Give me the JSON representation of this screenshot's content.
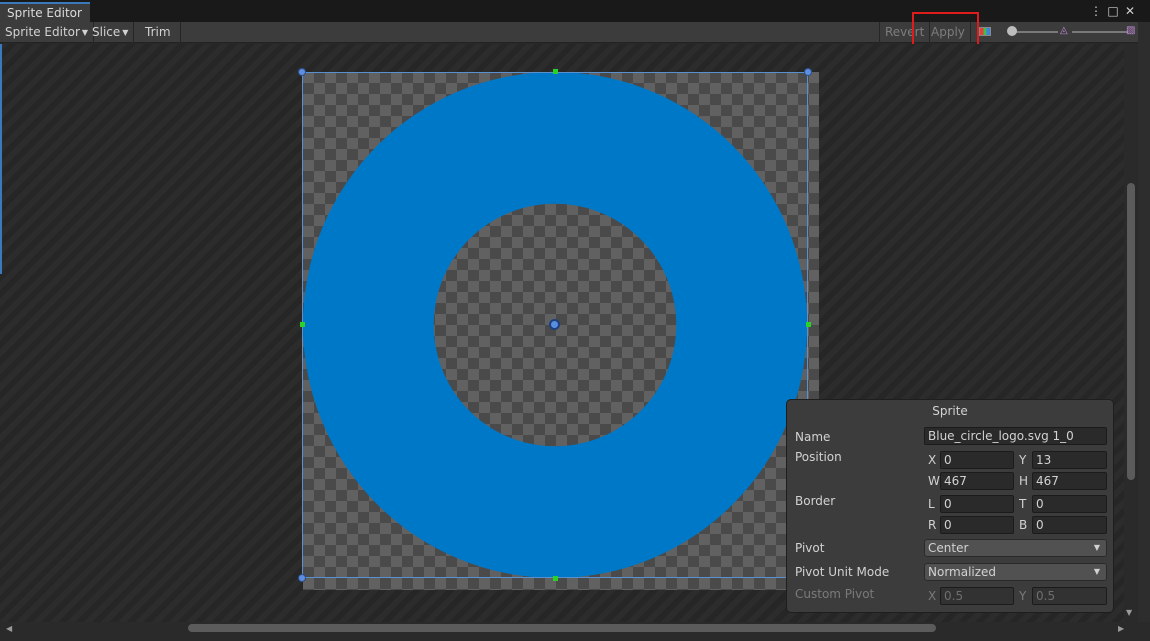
{
  "window": {
    "tab_title": "Sprite Editor",
    "menu_icon": "⋮",
    "maximize_icon": "□",
    "close_icon": "✕"
  },
  "toolbar": {
    "sprite_editor_label": "Sprite Editor",
    "slice_label": "Slice",
    "trim_label": "Trim",
    "revert_label": "Revert",
    "apply_label": "Apply",
    "dropdown_caret": "▼"
  },
  "sprite_panel": {
    "title": "Sprite",
    "name_label": "Name",
    "name_value": "Blue_circle_logo.svg 1_0",
    "position_label": "Position",
    "x_label": "X",
    "x_value": "0",
    "y_label": "Y",
    "y_value": "13",
    "w_label": "W",
    "w_value": "467",
    "h_label": "H",
    "h_value": "467",
    "border_label": "Border",
    "l_label": "L",
    "l_value": "0",
    "t_label": "T",
    "t_value": "0",
    "r_label": "R",
    "r_value": "0",
    "b_label": "B",
    "b_value": "0",
    "pivot_label": "Pivot",
    "pivot_value": "Center",
    "pivot_unit_label": "Pivot Unit Mode",
    "pivot_unit_value": "Normalized",
    "custom_pivot_label": "Custom Pivot",
    "cx_label": "X",
    "cx_value": "0.5",
    "cy_label": "Y",
    "cy_value": "0.5"
  },
  "colors": {
    "sprite_blue": "#0078c8",
    "highlight": "#e01b1b",
    "handle_green": "#29d129"
  }
}
